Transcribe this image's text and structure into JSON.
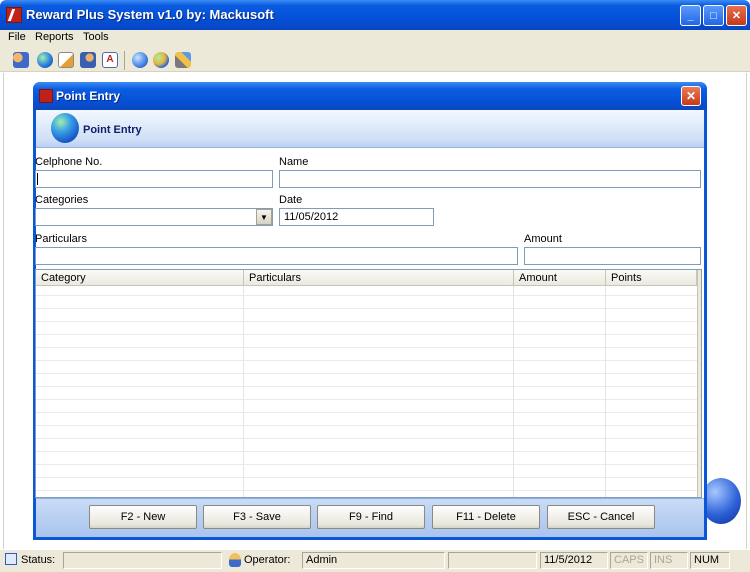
{
  "app": {
    "title": "Reward Plus System v1.0 by: Mackusoft",
    "caption_buttons": {
      "minimize": "_",
      "maximize": "□",
      "close": "✕"
    }
  },
  "menu": {
    "items": [
      "File",
      "Reports",
      "Tools"
    ]
  },
  "toolbar": {
    "icons": [
      "users-icon",
      "globe-icon",
      "edit-icon",
      "group-icon",
      "document-icon",
      "world-icon",
      "world-settings-icon",
      "tools-icon"
    ]
  },
  "child_window": {
    "title": "Point Entry",
    "header_title": "Point Entry",
    "close_glyph": "✕"
  },
  "form": {
    "celphone_label": "Celphone No.",
    "celphone_value": "",
    "name_label": "Name",
    "name_value": "",
    "categories_label": "Categories",
    "categories_value": "",
    "date_label": "Date",
    "date_value": "11/05/2012",
    "particulars_label": "Particulars",
    "particulars_value": "",
    "amount_label": "Amount",
    "amount_value": ""
  },
  "grid": {
    "columns": [
      "Category",
      "Particulars",
      "Amount",
      "Points"
    ],
    "rows": []
  },
  "buttons": {
    "new": "F2 - New",
    "save": "F3 - Save",
    "find": "F9 - Find",
    "delete": "F11 - Delete",
    "cancel": "ESC - Cancel"
  },
  "statusbar": {
    "status_label": "Status:",
    "status_value": "",
    "operator_label": "Operator:",
    "operator_value": "Admin",
    "date": "11/5/2012",
    "caps": "CAPS",
    "ins": "INS",
    "num": "NUM"
  },
  "colors": {
    "titlebar": "#0550d8",
    "window_bg": "#ece9d8",
    "header_gradient": "#cfdff7",
    "close_red": "#c63a18"
  }
}
